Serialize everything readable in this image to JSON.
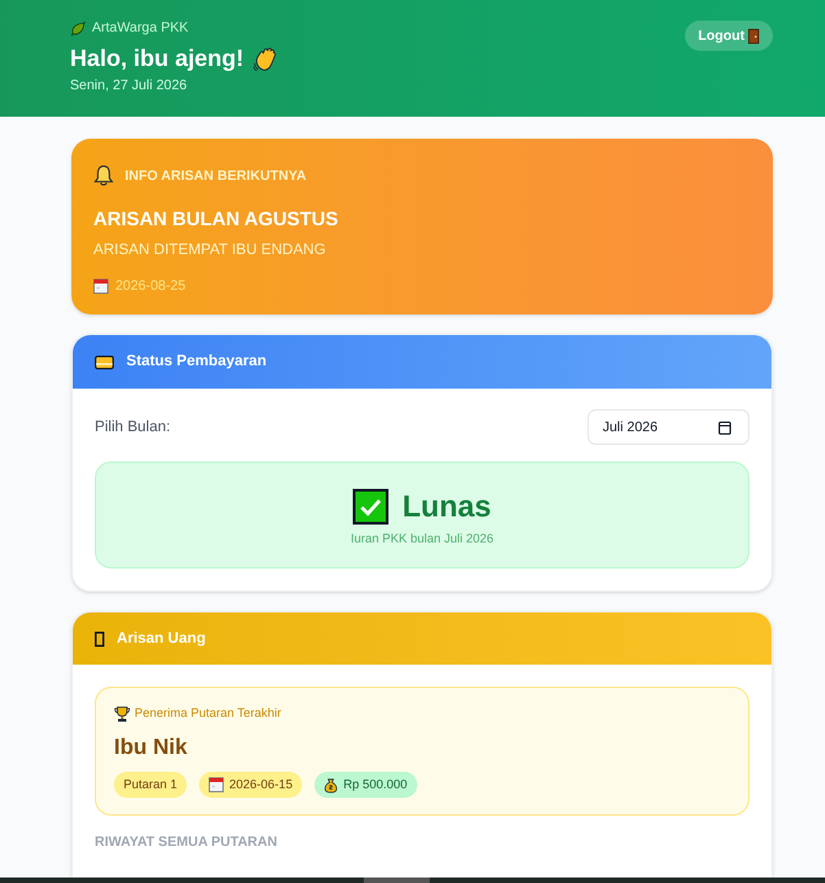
{
  "header": {
    "brand": "ArtaWarga PKK",
    "greeting": "Halo, ibu ajeng!",
    "date": "Senin, 27 Juli 2026",
    "logout_button": "Logout"
  },
  "next_arisan": {
    "label": "INFO ARISAN BERIKUTNYA",
    "title": "ARISAN BULAN AGUSTUS",
    "description": "ARISAN DITEMPAT IBU ENDANG",
    "date": "2026-08-25"
  },
  "payment_status": {
    "title": "Status Pembayaran",
    "month_label": "Pilih Bulan:",
    "month_value": "Juli 2026",
    "status": {
      "kind": "paid",
      "label": "Lunas",
      "note": "Iuran PKK bulan Juli 2026"
    }
  },
  "arisan_uang": {
    "title": "Arisan Uang",
    "latest_recipient": {
      "label": "Penerima Putaran Terakhir",
      "name": "Ibu Nik",
      "badges": [
        {
          "kind": "round",
          "text": "Putaran 1"
        },
        {
          "kind": "date",
          "text": "2026-06-15"
        },
        {
          "kind": "amount",
          "text": "Rp 500.000"
        }
      ]
    },
    "history_heading": "RIWAYAT SEMUA PUTARAN"
  }
}
